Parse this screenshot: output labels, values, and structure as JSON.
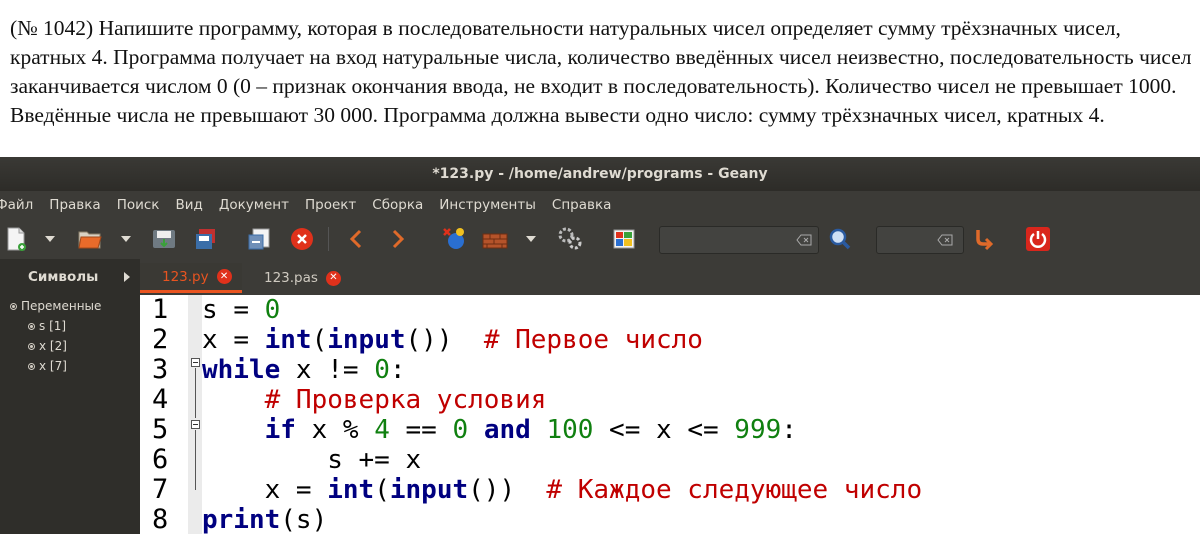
{
  "task_text": "(№ 1042) Напишите программу, которая в последовательности натуральных чисел определяет сумму трёхзначных чисел, кратных 4. Программа получает на вход натуральные числа, количество введённых чисел неизвестно, последовательность чисел заканчивается числом 0 (0 – признак окончания ввода, не входит в последовательность). Количество чисел не превышает 1000. Введённые числа не превышают 30 000. Программа должна вывести одно число: сумму трёхзначных чисел, кратных 4.",
  "window": {
    "title": "*123.py - /home/andrew/programs - Geany"
  },
  "menu": [
    "Файл",
    "Правка",
    "Поиск",
    "Вид",
    "Документ",
    "Проект",
    "Сборка",
    "Инструменты",
    "Справка"
  ],
  "toolbar": {
    "icons": [
      "new-file-icon",
      "open-file-icon",
      "save-icon",
      "save-all-icon",
      "revert-icon",
      "close-file-icon",
      "back-icon",
      "forward-icon",
      "compile-icon",
      "build-icon",
      "execute-icon",
      "color-chooser-icon",
      "search-icon",
      "jump-to-line-icon",
      "quit-icon"
    ],
    "search_value": "",
    "goto_value": ""
  },
  "sidebar": {
    "tab_label": "Символы",
    "group_label": "Переменные",
    "items": [
      "s [1]",
      "x [2]",
      "x [7]"
    ]
  },
  "tabs": [
    {
      "label": "123.py",
      "active": true
    },
    {
      "label": "123.pas",
      "active": false
    }
  ],
  "editor": {
    "line_numbers": [
      "1",
      "2",
      "3",
      "4",
      "5",
      "6",
      "7",
      "8"
    ],
    "lines": [
      [
        {
          "t": "s ",
          "c": ""
        },
        {
          "t": "=",
          "c": "op"
        },
        {
          "t": " ",
          "c": ""
        },
        {
          "t": "0",
          "c": "num"
        }
      ],
      [
        {
          "t": "x ",
          "c": ""
        },
        {
          "t": "=",
          "c": "op"
        },
        {
          "t": " ",
          "c": ""
        },
        {
          "t": "int",
          "c": "bi"
        },
        {
          "t": "(",
          "c": ""
        },
        {
          "t": "input",
          "c": "bi"
        },
        {
          "t": "())  ",
          "c": ""
        },
        {
          "t": "# Первое число",
          "c": "cm"
        }
      ],
      [
        {
          "t": "while",
          "c": "kw"
        },
        {
          "t": " x != ",
          "c": ""
        },
        {
          "t": "0",
          "c": "num"
        },
        {
          "t": ":",
          "c": ""
        }
      ],
      [
        {
          "t": "    ",
          "c": ""
        },
        {
          "t": "# Проверка условия",
          "c": "cm"
        }
      ],
      [
        {
          "t": "    ",
          "c": ""
        },
        {
          "t": "if",
          "c": "kw"
        },
        {
          "t": " x % ",
          "c": ""
        },
        {
          "t": "4",
          "c": "num"
        },
        {
          "t": " == ",
          "c": ""
        },
        {
          "t": "0",
          "c": "num"
        },
        {
          "t": " ",
          "c": ""
        },
        {
          "t": "and",
          "c": "kw"
        },
        {
          "t": " ",
          "c": ""
        },
        {
          "t": "100",
          "c": "num"
        },
        {
          "t": " <= x <= ",
          "c": ""
        },
        {
          "t": "999",
          "c": "num"
        },
        {
          "t": ":",
          "c": ""
        }
      ],
      [
        {
          "t": "        s += x",
          "c": ""
        }
      ],
      [
        {
          "t": "    x = ",
          "c": ""
        },
        {
          "t": "int",
          "c": "bi"
        },
        {
          "t": "(",
          "c": ""
        },
        {
          "t": "input",
          "c": "bi"
        },
        {
          "t": "())  ",
          "c": ""
        },
        {
          "t": "# Каждое следующее число",
          "c": "cm"
        }
      ],
      [
        {
          "t": "print",
          "c": "bi"
        },
        {
          "t": "(s)",
          "c": ""
        }
      ]
    ]
  },
  "colors": {
    "accent": "#e95420",
    "keyword": "#000080",
    "number": "#108010",
    "comment": "#c00000",
    "chrome": "#3c3b37"
  }
}
